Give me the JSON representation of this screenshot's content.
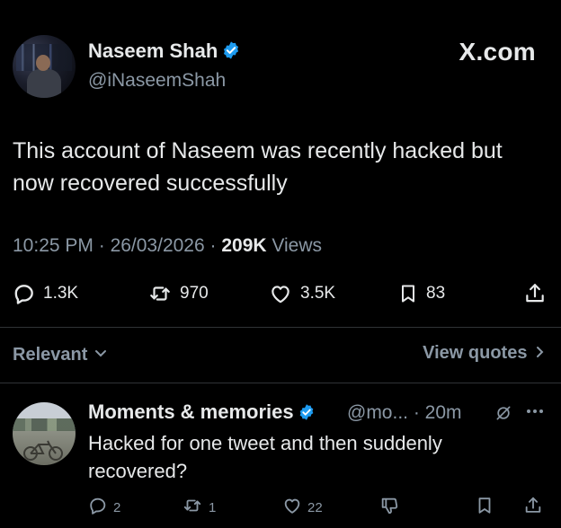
{
  "tweet": {
    "author_name": "Naseem Shah",
    "author_handle": "@iNaseemShah",
    "site_label": "X.com",
    "text": "This account of Naseem was recently hacked but now recovered successfully",
    "time": "10:25 PM",
    "date": "26/03/2026",
    "views_count": "209K",
    "views_label": "Views",
    "replies": "1.3K",
    "reposts": "970",
    "likes": "3.5K",
    "bookmarks": "83"
  },
  "replies_bar": {
    "sort_label": "Relevant",
    "view_quotes_label": "View quotes"
  },
  "reply": {
    "author_name": "Moments & memories",
    "author_handle": "@mo...",
    "time": "20m",
    "text": "Hacked for one tweet and then suddenly recovered?",
    "replies": "2",
    "reposts": "1",
    "likes": "22"
  },
  "colors": {
    "background": "#000000",
    "primary_text": "#e7e9ea",
    "secondary_text": "#8b98a5",
    "verified_blue": "#1d9bf0",
    "divider": "#2f3336"
  }
}
